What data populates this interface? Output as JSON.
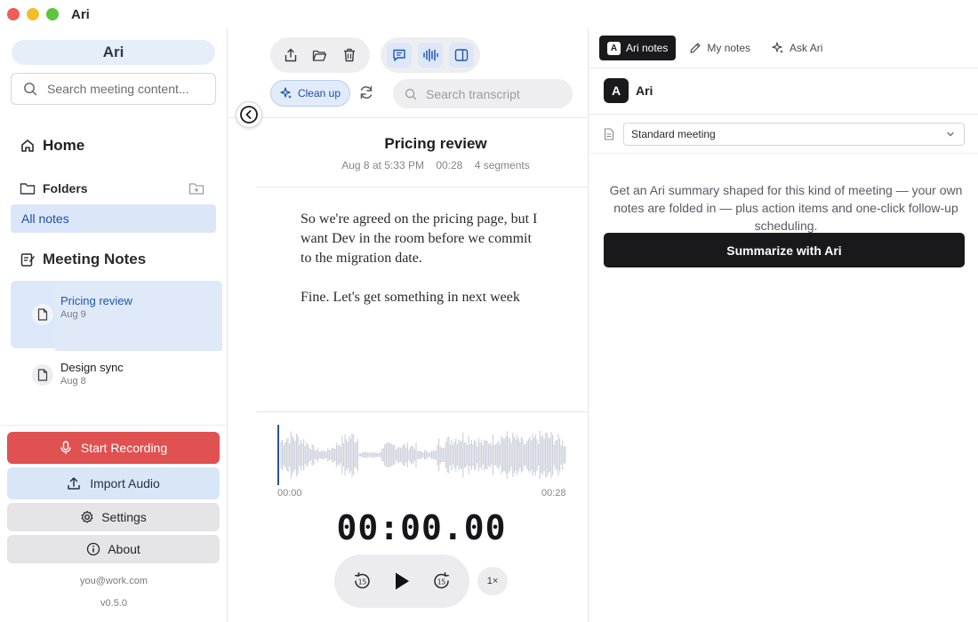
{
  "app": {
    "title": "Ari"
  },
  "sidebar": {
    "workspace": "Ari",
    "search_placeholder": "Search meeting content...",
    "home_label": "Home",
    "folders_label": "Folders",
    "all_notes_label": "All notes",
    "meeting_notes_label": "Meeting Notes",
    "notes": [
      {
        "title": "Pricing review",
        "date": "Aug 9",
        "active": true
      },
      {
        "title": "Design sync",
        "date": "Aug 8",
        "active": false
      }
    ],
    "start_recording_label": "Start Recording",
    "import_audio_label": "Import Audio",
    "settings_label": "Settings",
    "about_label": "About",
    "email": "you@work.com",
    "version": "v0.5.0"
  },
  "center": {
    "cleanup_label": "Clean up",
    "search_placeholder": "Search transcript",
    "meeting_title": "Pricing review",
    "meta": {
      "date": "Aug 8 at 5:33 PM",
      "duration": "00:28",
      "segments": "4 segments"
    },
    "transcript": [
      "So we're agreed on the pricing page, but I want Dev in the room before we commit to the migration date.",
      "Fine. Let's get something in next week"
    ],
    "player": {
      "time_start": "00:00",
      "time_end": "00:28",
      "timer": "00:00.00",
      "speed": "1×",
      "skip_back": "15",
      "skip_forward": "15"
    }
  },
  "right": {
    "tabs": [
      {
        "label": "Ari notes",
        "active": true
      },
      {
        "label": "My notes",
        "active": false
      },
      {
        "label": "Ask Ari",
        "active": false
      }
    ],
    "badge_letter": "A",
    "assistant_name": "Ari",
    "template_selected": "Standard meeting",
    "summary_description": "Get an Ari summary shaped for this kind of meeting — your own notes are folded in — plus action items and one-click follow-up scheduling.",
    "summarize_label": "Summarize with Ari"
  },
  "colors": {
    "accent_blue": "#1d4fa3",
    "record_red": "#e05151",
    "primary_dark": "#19191b",
    "selection_bg": "#dbe7f8"
  },
  "icons": {
    "search": "search-icon",
    "home": "home-icon",
    "folder": "folder-icon",
    "folder_add": "folder-add-icon",
    "notes": "notes-edit-icon",
    "document": "document-icon",
    "microphone": "microphone-icon",
    "upload": "upload-icon",
    "gear": "gear-icon",
    "info": "info-icon",
    "share": "share-icon",
    "folder_open": "folder-open-icon",
    "trash": "trash-icon",
    "chat": "chat-icon",
    "waveform": "waveform-icon",
    "sidebar": "sidebar-panel-icon",
    "sparkle": "sparkle-icon",
    "refresh": "refresh-icon",
    "chevron_left": "chevron-left-icon",
    "play": "play-icon",
    "pencil": "pencil-icon"
  }
}
